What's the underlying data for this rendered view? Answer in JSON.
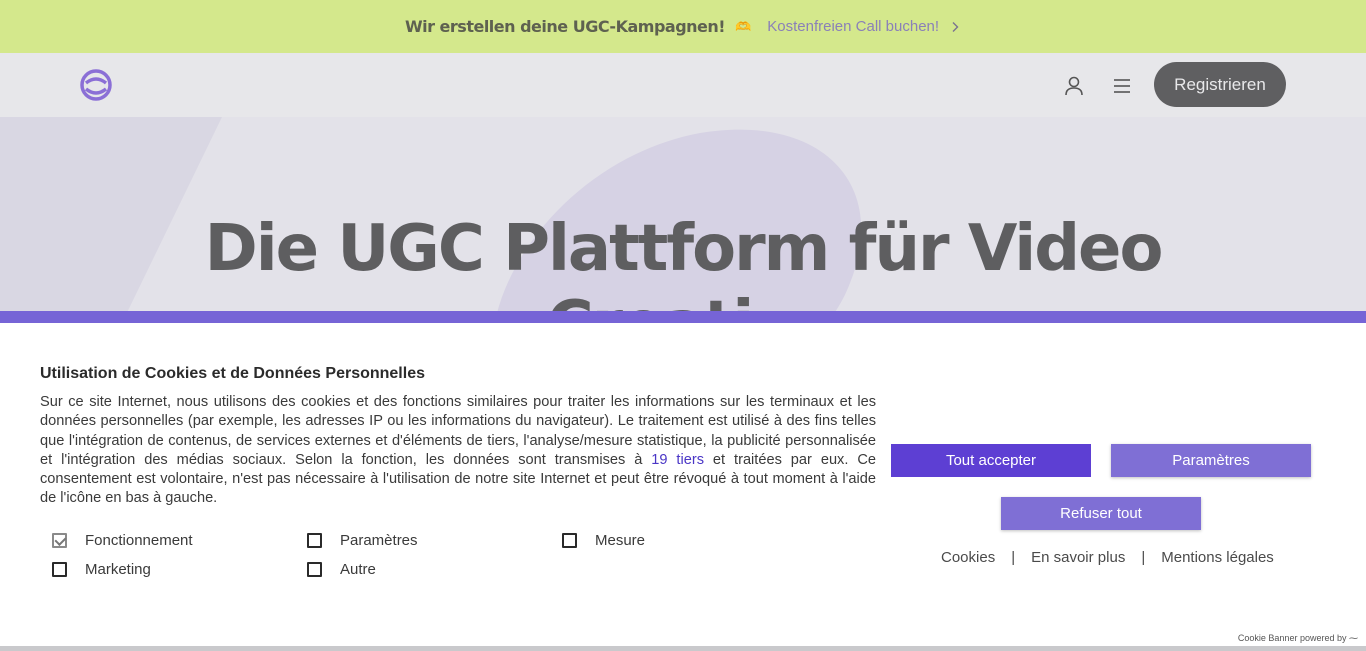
{
  "promo": {
    "title": "Wir erstellen deine UGC-Kampagnen!",
    "emoji": "🫶",
    "link": "Kostenfreien Call buchen!"
  },
  "header": {
    "register_label": "Registrieren",
    "icons": [
      "logo-icon",
      "user-icon",
      "menu-icon"
    ]
  },
  "hero": {
    "title_line1": "Die UGC Plattform für Video",
    "title_line2": "Creati..."
  },
  "cookie": {
    "title": "Utilisation de Cookies et de Données Personnelles",
    "text_before": "Sur ce site Internet, nous utilisons des cookies et des fonctions similaires pour traiter les informations sur les terminaux et les données personnelles (par exemple, les adresses IP ou les informations du navigateur). Le traitement est utilisé à des fins telles que l'intégration de contenus, de services externes et d'éléments de tiers, l'analyse/mesure statistique, la publicité personnalisée et l'intégration des médias sociaux. Selon la fonction, les données sont transmises à ",
    "tiers_link": "19 tiers",
    "text_after": " et traitées par eux. Ce consentement est volontaire, n'est pas nécessaire à l'utilisation de notre site Internet et peut être révoqué à tout moment à l'aide de l'icône en bas à gauche.",
    "options": {
      "functional": "Fonctionnement",
      "settings": "Paramètres",
      "measure": "Mesure",
      "marketing": "Marketing",
      "other": "Autre"
    },
    "buttons": {
      "accept_all": "Tout accepter",
      "settings": "Paramètres",
      "refuse_all": "Refuser tout"
    },
    "links": {
      "cookies": "Cookies",
      "sep": "|",
      "learn_more": "En savoir plus",
      "legal": "Mentions légales"
    },
    "powered_by": "Cookie Banner powered by"
  },
  "colors": {
    "promo_bg": "#d4e88c",
    "brand_purple": "#7664d6",
    "accept_button": "#5d3fd3",
    "secondary_button": "#7f6fd5"
  }
}
